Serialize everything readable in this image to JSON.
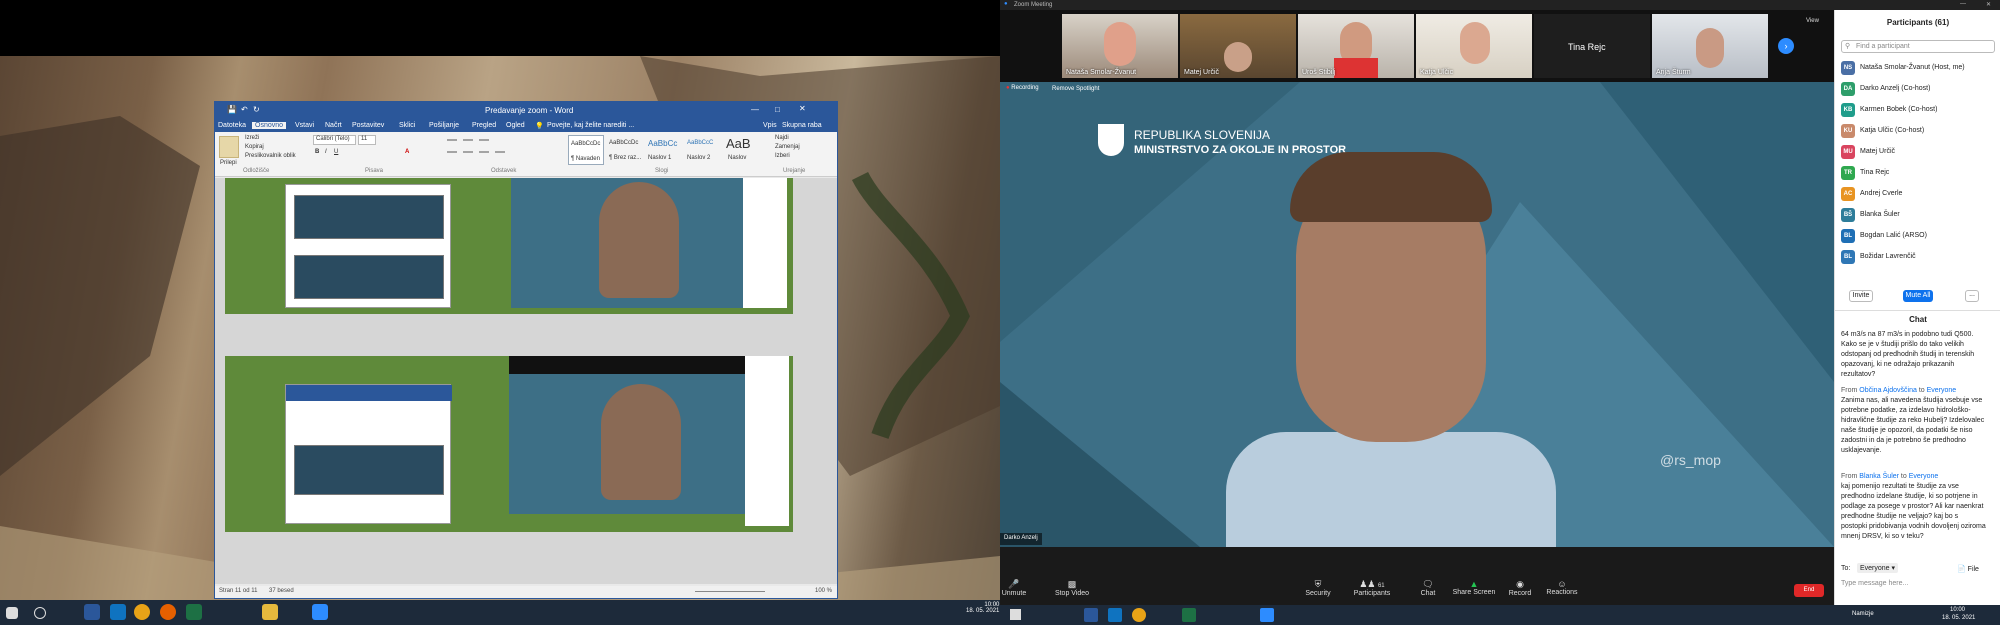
{
  "word": {
    "title": "Predavanje zoom - Word",
    "tell_me": "Povejte, kaj želite narediti ...",
    "user": "Vpis",
    "share": "Skupna raba",
    "tabs": [
      "Datoteka",
      "Osnovno",
      "Vstavi",
      "Načrt",
      "Postavitev",
      "Sklici",
      "Pošiljanje",
      "Pregled",
      "Ogled"
    ],
    "clipboard": {
      "paste": "Prilepi",
      "cut": "Izreži",
      "copy": "Kopiraj",
      "format_painter": "Preslikovalnik oblik",
      "group": "Odložišče"
    },
    "font": {
      "name": "Calibri (Telo)",
      "size": "11",
      "group": "Pisava"
    },
    "paragraph_group": "Odstavek",
    "styles": {
      "items": [
        "AaBbCcDc",
        "AaBbCcDc",
        "AaBbCc",
        "AaBbCcC",
        "AaB"
      ],
      "names": [
        "¶ Navaden",
        "¶ Brez raz...",
        "Naslov 1",
        "Naslov 2",
        "Naslov"
      ],
      "group": "Slogi"
    },
    "editing": {
      "find": "Najdi",
      "replace": "Zamenjaj",
      "select": "Izberi",
      "group": "Urejanje"
    },
    "status": {
      "page": "Stran 11 od 11",
      "words": "37 besed",
      "zoom": "100 %"
    }
  },
  "zoom": {
    "title": "Zoom Meeting",
    "view": "View",
    "gallery": [
      {
        "name": "Nataša Smolar-Žvanut"
      },
      {
        "name": "Matej Určič"
      },
      {
        "name": "Uroš Stibilj"
      },
      {
        "name": "Katja Ulčic"
      },
      {
        "name": "Tina Rejc"
      },
      {
        "name": "Anja Šturm"
      }
    ],
    "recording": "Recording",
    "remove_spotlight": "Remove Spotlight",
    "logo_line1": "REPUBLIKA SLOVENIJA",
    "logo_line2": "MINISTRSTVO ZA OKOLJE IN PROSTOR",
    "watermark": "@rs_mop",
    "speaker": "Darko Anzelj",
    "toolbar": [
      "Unmute",
      "Stop Video",
      "Security",
      "Participants",
      "Chat",
      "Share Screen",
      "Record",
      "Reactions"
    ],
    "participants_count": "61",
    "end": "End"
  },
  "panel": {
    "title": "Participants (61)",
    "search_placeholder": "Find a participant",
    "participants": [
      {
        "initials": "NS",
        "name": "Nataša Smolar-Žvanut (Host, me)",
        "color": "#4a6fa5"
      },
      {
        "initials": "DA",
        "name": "Darko Anzelj (Co-host)",
        "color": "#2e9e6b"
      },
      {
        "initials": "KB",
        "name": "Karmen Bobek (Co-host)",
        "color": "#1f9d8b"
      },
      {
        "initials": "KU",
        "name": "Katja Ulčic (Co-host)",
        "color": "#c98a6b"
      },
      {
        "initials": "MU",
        "name": "Matej Určič",
        "color": "#d9455f"
      },
      {
        "initials": "TR",
        "name": "Tina Rejc",
        "color": "#2fa84f"
      },
      {
        "initials": "AC",
        "name": "Andrej Cverle",
        "color": "#e89422"
      },
      {
        "initials": "BŠ",
        "name": "Blanka Šuler",
        "color": "#2e7d9a"
      },
      {
        "initials": "BL",
        "name": "Bogdan Lalić (ARSO)",
        "color": "#1f6fb5"
      },
      {
        "initials": "BL",
        "name": "Božidar Lavrenčič",
        "color": "#2f77b5"
      }
    ],
    "invite": "Invite",
    "mute_all": "Mute All",
    "more": "...",
    "chat_title": "Chat",
    "chat": [
      {
        "from": "",
        "to": "",
        "text": "64 m3/s na 87 m3/s in podobno tudi Q500. Kako se je v študiji prišlo do tako velikih odstopanj od predhodnih študij in terenskih opazovanj, ki ne odražajo prikazanih rezultatov?"
      },
      {
        "from": "Občina Ajdovščina",
        "to": "Everyone",
        "text": "Zanima nas, ali navedena študija vsebuje vse potrebne podatke, za izdelavo hidrološko-hidravlične študije za reko Hubelj? Izdelovalec naše študije je opozoril, da podatki še niso zadostni in da je potrebno še predhodno usklajevanje."
      },
      {
        "from": "Blanka Šuler",
        "to": "Everyone",
        "text": "kaj pomenijo rezultati te študije za vse predhodno izdelane študije, ki so potrjene in podlage za posege v prostor? Ali kar naenkrat predhodne študije ne veljajo? kaj bo s postopki pridobivanja vodnih dovoljenj oziroma mnenj DRSV, ki so v teku?"
      }
    ],
    "to_label": "To:",
    "to_value": "Everyone",
    "file": "File",
    "chat_placeholder": "Type message here..."
  },
  "taskbar": {
    "clock_left": "10:00\n18. 05. 2021",
    "lang": "Namizje",
    "time": "10:00",
    "date": "18. 05. 2021"
  }
}
